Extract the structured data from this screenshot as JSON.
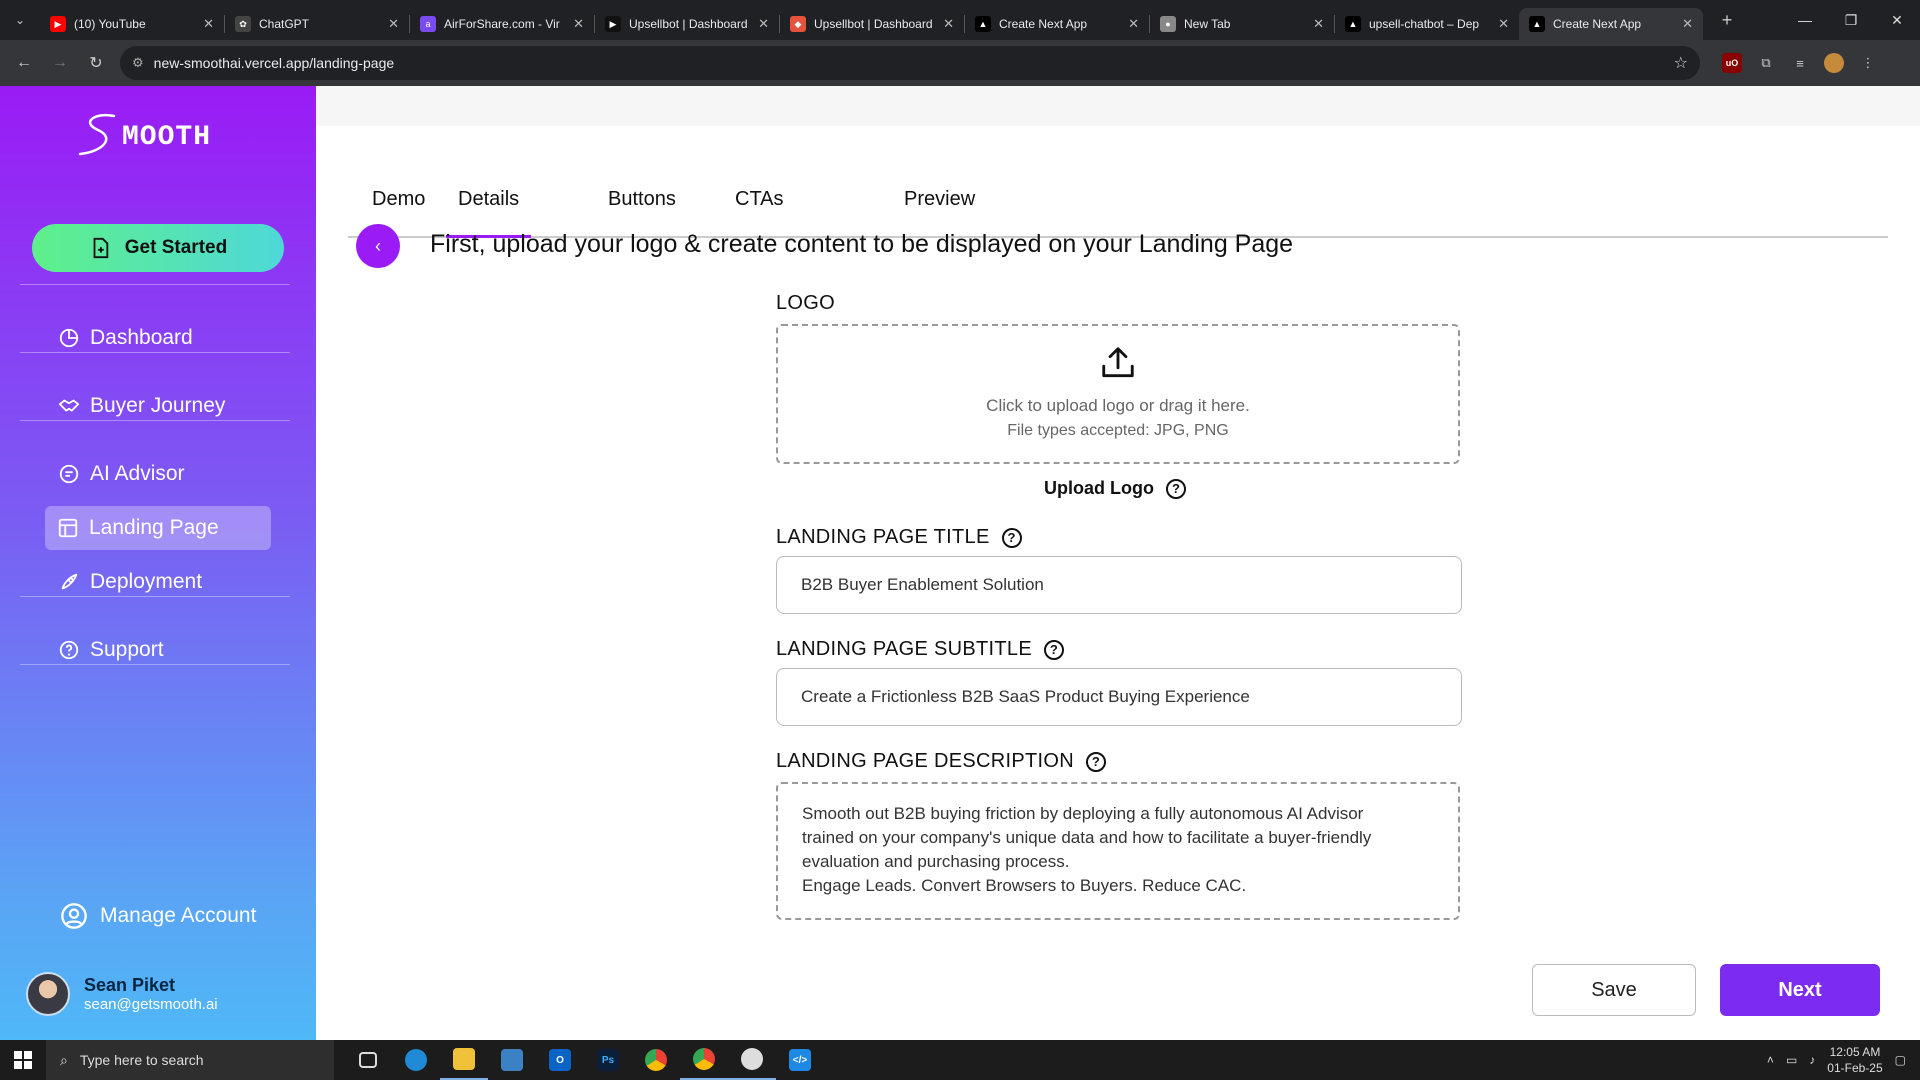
{
  "browser": {
    "tabs": [
      {
        "label": "(10) YouTube",
        "favicon": "youtube-icon",
        "color": "#ff0000"
      },
      {
        "label": "ChatGPT",
        "favicon": "chatgpt-icon",
        "color": "#444444"
      },
      {
        "label": "AirForShare.com - Vir",
        "favicon": "airforshare-icon",
        "color": "#7a4cf0"
      },
      {
        "label": "Upsellbot | Dashboard",
        "favicon": "play-icon",
        "color": "#111111"
      },
      {
        "label": "Upsellbot | Dashboard",
        "favicon": "figma-icon",
        "color": "#e5533d"
      },
      {
        "label": "Create Next App",
        "favicon": "vercel-icon",
        "color": "#000000"
      },
      {
        "label": "New Tab",
        "favicon": "chrome-icon",
        "color": "#888888"
      },
      {
        "label": "upsell-chatbot – Dep",
        "favicon": "vercel-icon",
        "color": "#000000"
      },
      {
        "label": "Create Next App",
        "favicon": "vercel-icon",
        "color": "#000000",
        "active": true
      }
    ],
    "url": "new-smoothai.vercel.app/landing-page"
  },
  "sidebar": {
    "logo_text": "SMOOTH",
    "get_started": "Get Started",
    "items": [
      {
        "label": "Dashboard",
        "icon": "pie-chart-icon"
      },
      {
        "label": "Buyer Journey",
        "icon": "handshake-icon"
      },
      {
        "label": "AI Advisor",
        "icon": "chat-icon"
      },
      {
        "label": "Landing Page",
        "icon": "layout-icon",
        "active": true
      },
      {
        "label": "Deployment",
        "icon": "rocket-icon"
      },
      {
        "label": "Support",
        "icon": "help-icon"
      }
    ],
    "manage_account": "Manage Account",
    "user": {
      "name": "Sean Piket",
      "email": "sean@getsmooth.ai"
    }
  },
  "main": {
    "tabs": [
      "Demo",
      "Details",
      "Buttons",
      "CTAs",
      "Preview"
    ],
    "active_tab": "Details",
    "headline": "First, upload your logo & create content to be displayed on your Landing Page",
    "logo_label": "LOGO",
    "upload_line1": "Click to upload logo or drag it here.",
    "upload_line2": "File types accepted: JPG, PNG",
    "upload_logo": "Upload Logo",
    "title_label": "LANDING PAGE TITLE",
    "title_value": "B2B Buyer Enablement Solution",
    "subtitle_label": "LANDING PAGE SUBTITLE",
    "subtitle_value": "Create a Frictionless B2B SaaS Product Buying Experience",
    "description_label": "LANDING PAGE DESCRIPTION",
    "description_lines": [
      "Smooth out B2B buying friction by deploying a fully autonomous AI Advisor",
      "trained on your company's unique data and how to facilitate a buyer-friendly",
      "evaluation and purchasing process.",
      "Engage Leads. Convert Browsers to Buyers. Reduce CAC."
    ],
    "save": "Save",
    "next": "Next"
  },
  "taskbar": {
    "search_placeholder": "Type here to search",
    "time": "12:05 AM",
    "date": "01-Feb-25"
  },
  "colors": {
    "accent": "#9a1bf5",
    "next_button": "#7c2cf0",
    "get_started_from": "#5ef08a",
    "get_started_to": "#4ed8d8"
  }
}
